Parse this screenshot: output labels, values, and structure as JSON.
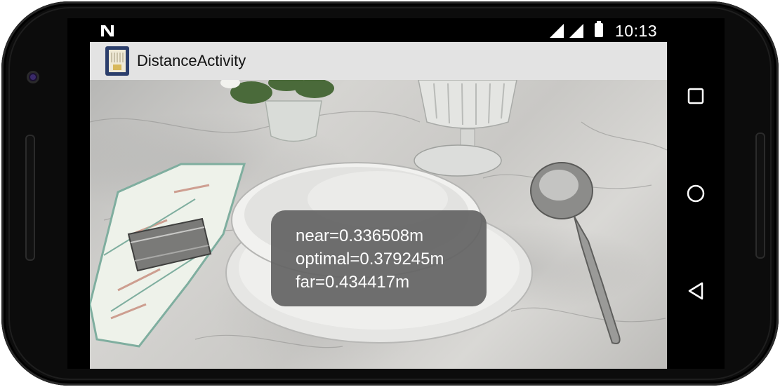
{
  "status_bar": {
    "time": "10:13",
    "icons": [
      "notification-n-icon",
      "signal-icon",
      "signal-icon",
      "battery-icon"
    ]
  },
  "action_bar": {
    "title": "DistanceActivity",
    "app_icon": "app-icon"
  },
  "camera_preview": {
    "scene": "table-setting-photo"
  },
  "distance_overlay": {
    "near": "near=0.336508m",
    "optimal": "optimal=0.379245m",
    "far": "far=0.434417m"
  },
  "nav_bar": {
    "icons": [
      "recent-apps-icon",
      "home-icon",
      "back-icon"
    ]
  },
  "colors": {
    "action_bar_bg": "#e3e3e3",
    "overlay_bg": "#646464",
    "nav_bg": "#000000"
  }
}
